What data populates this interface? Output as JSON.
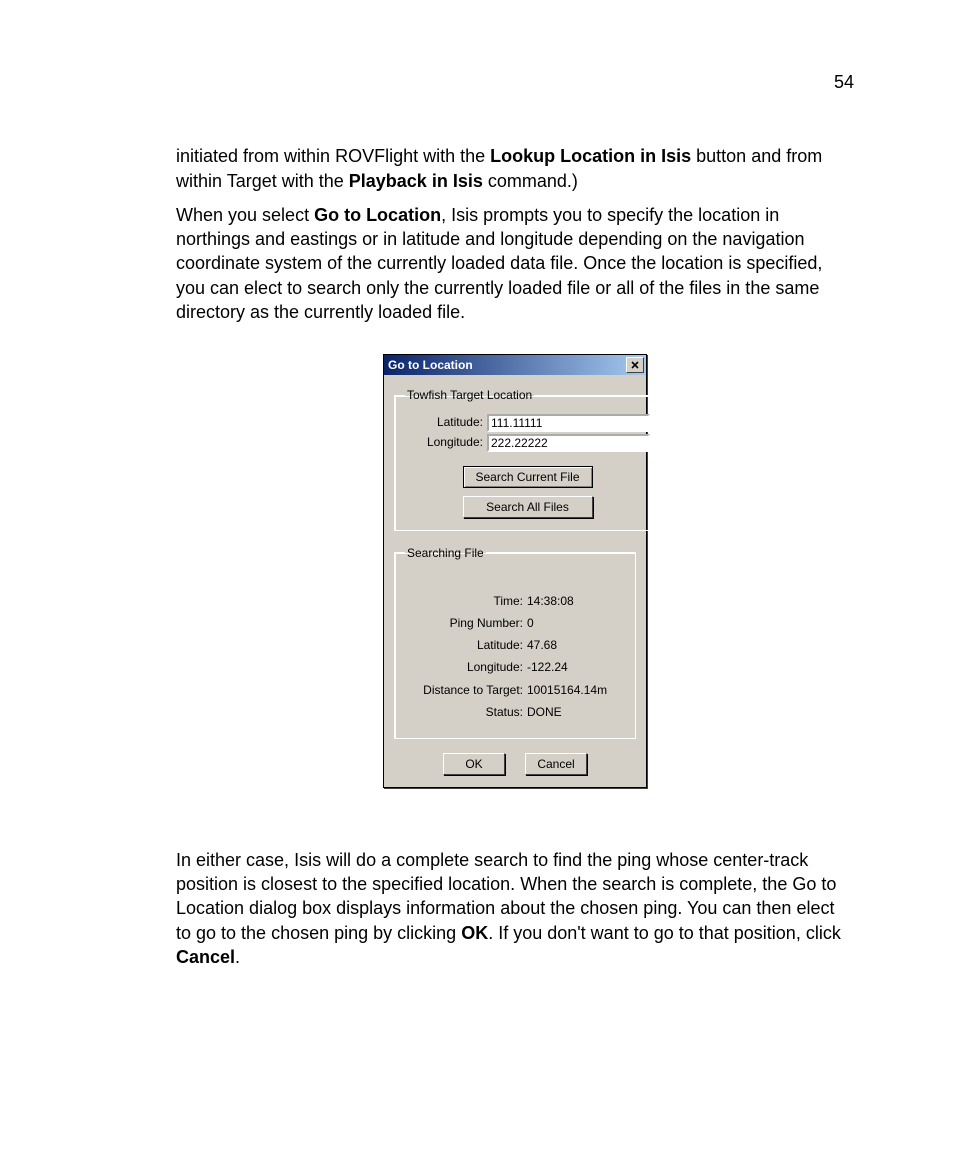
{
  "page_number": "54",
  "para1_pre": "initiated from within ROVFlight with the ",
  "para1_b1": "Lookup Location in Isis",
  "para1_mid": " button and from within Target with the ",
  "para1_b2": "Playback in Isis",
  "para1_end": " command.)",
  "para2_pre": "When you select ",
  "para2_b1": "Go to Location",
  "para2_end": ", Isis prompts you to specify the location in northings and eastings or in latitude and longitude depending on the navigation coordinate system of the currently loaded data file. Once the location is specified, you can elect to search only the currently loaded file or all of the files in the same directory as the currently loaded file.",
  "dialog": {
    "title": "Go to Location",
    "close": "✕",
    "group1": {
      "legend": "Towfish Target Location",
      "lat_label": "Latitude:",
      "lat_value": "111.11111",
      "lon_label": "Longitude:",
      "lon_value": "222.22222",
      "btn_current": "Search Current File",
      "btn_all": "Search All Files"
    },
    "group2": {
      "legend": "Searching File",
      "rows": {
        "time_label": "Time:",
        "time_val": "14:38:08",
        "ping_label": "Ping Number:",
        "ping_val": "0",
        "lat_label": "Latitude:",
        "lat_val": "47.68",
        "lon_label": "Longitude:",
        "lon_val": "-122.24",
        "dist_label": "Distance to Target:",
        "dist_val": "10015164.14m",
        "status_label": "Status:",
        "status_val": "DONE"
      }
    },
    "ok": "OK",
    "cancel": "Cancel"
  },
  "para3_pre": "In either case, Isis will do a complete search to find the ping whose center-track position is closest to the specified location. When the search is complete, the Go to Location dialog box displays information about the chosen ping. You can then elect to go to the chosen ping by clicking ",
  "para3_b1": "OK",
  "para3_mid": ". If you don't want to go to that position, click ",
  "para3_b2": "Cancel",
  "para3_end": "."
}
